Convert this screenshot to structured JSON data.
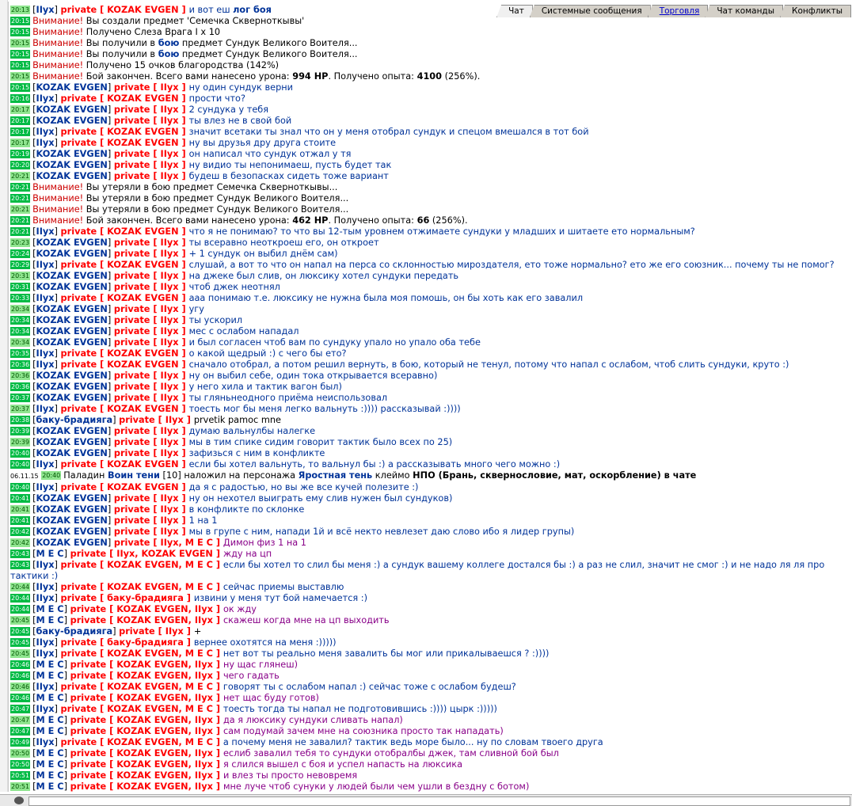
{
  "tabs": [
    {
      "label": "Чат",
      "active": true,
      "link": false
    },
    {
      "label": "Системные сообщения",
      "active": false,
      "link": false
    },
    {
      "label": "Торговля",
      "active": false,
      "link": true
    },
    {
      "label": "Чат команды",
      "active": false,
      "link": false
    },
    {
      "label": "Конфликты",
      "active": false,
      "link": false
    }
  ],
  "messages": [
    {
      "t": "20:13",
      "k": "c",
      "s": "IIух",
      "r": "KOZAK EVGEN",
      "x": "и вот еш ",
      "extra": "лог боя",
      "c": "b"
    },
    {
      "t": "20:15",
      "k": "w",
      "x": "Вы создали предмет 'Семечка Скверноткывы'"
    },
    {
      "t": "20:15",
      "k": "w",
      "x": "Получено Слеза Врага I x 10"
    },
    {
      "t": "20:15",
      "k": "w",
      "x": "Вы получили в ",
      "extra": "бою",
      "x2": " предмет Сундук Великого Воителя..."
    },
    {
      "t": "20:15",
      "k": "w",
      "x": "Вы получили в ",
      "extra": "бою",
      "x2": " предмет Сундук Великого Воителя..."
    },
    {
      "t": "20:15",
      "k": "w",
      "x": "Получено 15 очков благородства (142%)"
    },
    {
      "t": "20:15",
      "k": "w",
      "x": "Бой закончен. Всего вами нанесено урона: ",
      "b1": "994 HP",
      "x2": ". Получено опыта: ",
      "b2": "4100",
      "x3": " (256%)."
    },
    {
      "t": "20:15",
      "k": "c",
      "s": "KOZAK EVGEN",
      "r": "IIух",
      "x": "ну один сундук верни",
      "c": "b"
    },
    {
      "t": "20:16",
      "k": "c",
      "s": "IIух",
      "r": "KOZAK EVGEN",
      "x": "прости что?",
      "c": "b"
    },
    {
      "t": "20:17",
      "k": "c",
      "s": "KOZAK EVGEN",
      "r": "IIух",
      "x": "2 сундука у тебя",
      "c": "b"
    },
    {
      "t": "20:17",
      "k": "c",
      "s": "KOZAK EVGEN",
      "r": "IIух",
      "x": "ты влез не в свой бой",
      "c": "b"
    },
    {
      "t": "20:17",
      "k": "c",
      "s": "IIух",
      "r": "KOZAK EVGEN",
      "x": "значит всетаки ты знал что он у меня отобрал сундук и спецом вмешался в тот бой",
      "c": "b"
    },
    {
      "t": "20:17",
      "k": "c",
      "s": "IIух",
      "r": "KOZAK EVGEN",
      "x": "ну вы друзья дру друга стоите",
      "c": "b"
    },
    {
      "t": "20:19",
      "k": "c",
      "s": "KOZAK EVGEN",
      "r": "IIух",
      "x": "он написал что сундук отжал у тя",
      "c": "b"
    },
    {
      "t": "20:20",
      "k": "c",
      "s": "KOZAK EVGEN",
      "r": "IIух",
      "x": "ну видио ты непонимаеш, пусть будет так",
      "c": "b"
    },
    {
      "t": "20:21",
      "k": "c",
      "s": "KOZAK EVGEN",
      "r": "IIух",
      "x": "будеш в безопасках сидеть тоже вариант",
      "c": "b"
    },
    {
      "t": "20:21",
      "k": "w",
      "x": "Вы утеряли в бою предмет Семечка Скверноткывы..."
    },
    {
      "t": "20:21",
      "k": "w",
      "x": "Вы утеряли в бою предмет Сундук Великого Воителя..."
    },
    {
      "t": "20:21",
      "k": "w",
      "x": "Вы утеряли в бою предмет Сундук Великого Воителя..."
    },
    {
      "t": "20:21",
      "k": "w",
      "x": "Бой закончен. Всего вами нанесено урона: ",
      "b1": "462 HP",
      "x2": ". Получено опыта: ",
      "b2": "66",
      "x3": " (256%)."
    },
    {
      "t": "20:21",
      "k": "c",
      "s": "IIух",
      "r": "KOZAK EVGEN",
      "x": "что я не понимаю? то что вы 12-тым уровнем отжимаете сундуки у младших и шитаете ето нормальным?",
      "c": "b"
    },
    {
      "t": "20:23",
      "k": "c",
      "s": "KOZAK EVGEN",
      "r": "IIух",
      "x": "ты всеравно неоткроеш его, он откроет",
      "c": "b"
    },
    {
      "t": "20:24",
      "k": "c",
      "s": "KOZAK EVGEN",
      "r": "IIух",
      "x": "+ 1 сундук он выбил днём сам)",
      "c": "b"
    },
    {
      "t": "20:29",
      "k": "c",
      "s": "IIух",
      "r": "KOZAK EVGEN",
      "x": "слушай, а вот то что он напал на перса со склонностью мироздателя, ето тоже нормально? ето же его союзник... почему ты не помог?",
      "c": "b"
    },
    {
      "t": "20:31",
      "k": "c",
      "s": "KOZAK EVGEN",
      "r": "IIух",
      "x": "на джеке был слив, он люксику хотел сундуки передать",
      "c": "b"
    },
    {
      "t": "20:31",
      "k": "c",
      "s": "KOZAK EVGEN",
      "r": "IIух",
      "x": "чтоб джек неотнял",
      "c": "b"
    },
    {
      "t": "20:33",
      "k": "c",
      "s": "IIух",
      "r": "KOZAK EVGEN",
      "x": "ааа понимаю т.е. люксику не нужна была моя помошь, он бы хоть как его завалил",
      "c": "b"
    },
    {
      "t": "20:34",
      "k": "c",
      "s": "KOZAK EVGEN",
      "r": "IIух",
      "x": "угу",
      "c": "b"
    },
    {
      "t": "20:34",
      "k": "c",
      "s": "KOZAK EVGEN",
      "r": "IIух",
      "x": "ты ускорил",
      "c": "b"
    },
    {
      "t": "20:34",
      "k": "c",
      "s": "KOZAK EVGEN",
      "r": "IIух",
      "x": "мес с ослабом нападал",
      "c": "b"
    },
    {
      "t": "20:34",
      "k": "c",
      "s": "KOZAK EVGEN",
      "r": "IIух",
      "x": "и был согласен чтоб вам по сундуку упало но упало оба тебе",
      "c": "b"
    },
    {
      "t": "20:35",
      "k": "c",
      "s": "IIух",
      "r": "KOZAK EVGEN",
      "x": "о какой щедрый :) с чего бы ето?",
      "c": "b"
    },
    {
      "t": "20:36",
      "k": "c",
      "s": "IIух",
      "r": "KOZAK EVGEN",
      "x": "сначало отобрал, а потом решил вернуть, в бою, который не тенул, потому что напал с ослабом, чтоб слить сундуки, круто :)",
      "c": "b"
    },
    {
      "t": "20:36",
      "k": "c",
      "s": "KOZAK EVGEN",
      "r": "IIух",
      "x": "ну он выбил себе, один тока открывается всеравно)",
      "c": "b"
    },
    {
      "t": "20:36",
      "k": "c",
      "s": "KOZAK EVGEN",
      "r": "IIух",
      "x": "у него хила и тактик вагон был)",
      "c": "b"
    },
    {
      "t": "20:37",
      "k": "c",
      "s": "KOZAK EVGEN",
      "r": "IIух",
      "x": "ты гляньнеодного приёма неиспользовал",
      "c": "b"
    },
    {
      "t": "20:37",
      "k": "c",
      "s": "IIух",
      "r": "KOZAK EVGEN",
      "x": "тоесть мог бы меня легко вальнуть :)))) рассказывай :))))",
      "c": "b"
    },
    {
      "t": "20:38",
      "k": "c",
      "s": "баку-брадияга",
      "r": "IIух",
      "x": "prvetik pamoc mne",
      "c": "k"
    },
    {
      "t": "20:39",
      "k": "c",
      "s": "KOZAK EVGEN",
      "r": "IIух",
      "x": "думаю вальнулбы налегке",
      "c": "b"
    },
    {
      "t": "20:39",
      "k": "c",
      "s": "KOZAK EVGEN",
      "r": "IIух",
      "x": "мы в тим спике сидим говорит тактик было всех по 25)",
      "c": "b"
    },
    {
      "t": "20:40",
      "k": "c",
      "s": "KOZAK EVGEN",
      "r": "IIух",
      "x": "зафизься с ним в конфликте",
      "c": "b"
    },
    {
      "t": "20:40",
      "k": "c",
      "s": "IIух",
      "r": "KOZAK EVGEN",
      "x": "если бы хотел вальнуть, то вальнул бы :) а рассказывать много чего можно :)",
      "c": "b"
    },
    {
      "t": "20:40",
      "k": "sys",
      "d": "06.11.15",
      "x": "Паладин ",
      "n1": "Воин тени",
      "x2": " [10] наложил на персонажа ",
      "n2": "Яростная тень",
      "x3": " клеймо ",
      "n3": "НПО (Брань, сквернословие, мат, оскорбление) в чате"
    },
    {
      "t": "20:40",
      "k": "c",
      "s": "IIух",
      "r": "KOZAK EVGEN",
      "x": "да я с радостью, но вы же все кучей полезите :)",
      "c": "b"
    },
    {
      "t": "20:41",
      "k": "c",
      "s": "KOZAK EVGEN",
      "r": "IIух",
      "x": "ну он нехотел выиграть ему слив нужен был сундуков)",
      "c": "b"
    },
    {
      "t": "20:41",
      "k": "c",
      "s": "KOZAK EVGEN",
      "r": "IIух",
      "x": "в конфликте по склонке",
      "c": "b"
    },
    {
      "t": "20:41",
      "k": "c",
      "s": "KOZAK EVGEN",
      "r": "IIух",
      "x": "1 на 1",
      "c": "b"
    },
    {
      "t": "20:42",
      "k": "c",
      "s": "KOZAK EVGEN",
      "r": "IIух",
      "x": "мы в групе с ним, напади 1й и всё некто невлезет даю слово ибо я лидер групы)",
      "c": "b"
    },
    {
      "t": "20:42",
      "k": "c",
      "s": "KOZAK EVGEN",
      "r": "IIух, M E C",
      "x": "Димон физ 1 на 1",
      "c": "p"
    },
    {
      "t": "20:43",
      "k": "c",
      "s": "M E C",
      "r": "IIух, KOZAK EVGEN",
      "x": "жду на цп",
      "c": "p"
    },
    {
      "t": "20:43",
      "k": "c",
      "s": "IIух",
      "r": "KOZAK EVGEN, M E C",
      "x": "если бы хотел то слил бы меня :) а сундук вашему коллеге достался бы :) а раз не слил, значит не смог :) и не надо ля ля про тактики :)",
      "c": "b",
      "wrap": true
    },
    {
      "t": "20:44",
      "k": "c",
      "s": "IIух",
      "r": "KOZAK EVGEN, M E C",
      "x": "сейчас приемы выставлю",
      "c": "b"
    },
    {
      "t": "20:44",
      "k": "c",
      "s": "IIух",
      "r": "баку-брадияга",
      "x": "извини у меня тут бой намечается :)",
      "c": "b"
    },
    {
      "t": "20:44",
      "k": "c",
      "s": "M E C",
      "r": "KOZAK EVGEN, IIух",
      "x": "ок жду",
      "c": "p"
    },
    {
      "t": "20:45",
      "k": "c",
      "s": "M E C",
      "r": "KOZAK EVGEN, IIух",
      "x": "скажеш когда мне на цп выходить",
      "c": "p"
    },
    {
      "t": "20:45",
      "k": "c",
      "s": "баку-брадияга",
      "r": "IIух",
      "x": "+",
      "c": "k"
    },
    {
      "t": "20:45",
      "k": "c",
      "s": "IIух",
      "r": "баку-брадияга",
      "x": "вернее охотятся на меня :)))))",
      "c": "b"
    },
    {
      "t": "20:45",
      "k": "c",
      "s": "IIух",
      "r": "KOZAK EVGEN, M E C",
      "x": "нет вот ты реально меня завалить бы мог или прикалываешся ? :))))",
      "c": "b"
    },
    {
      "t": "20:46",
      "k": "c",
      "s": "M E C",
      "r": "KOZAK EVGEN, IIух",
      "x": "ну щас глянеш)",
      "c": "p"
    },
    {
      "t": "20:46",
      "k": "c",
      "s": "M E C",
      "r": "KOZAK EVGEN, IIух",
      "x": "чего гадать",
      "c": "p"
    },
    {
      "t": "20:46",
      "k": "c",
      "s": "IIух",
      "r": "KOZAK EVGEN, M E C",
      "x": "говорят ты с ослабом напал :) сейчас тоже с ослабом будеш?",
      "c": "b"
    },
    {
      "t": "20:46",
      "k": "c",
      "s": "M E C",
      "r": "KOZAK EVGEN, IIух",
      "x": "нет щас буду готов)",
      "c": "p"
    },
    {
      "t": "20:47",
      "k": "c",
      "s": "IIух",
      "r": "KOZAK EVGEN, M E C",
      "x": "тоесть тогда ты напал не подготовившись :)))) цырк :)))))",
      "c": "b"
    },
    {
      "t": "20:47",
      "k": "c",
      "s": "M E C",
      "r": "KOZAK EVGEN, IIух",
      "x": "да я люксику сундуки сливать напал)",
      "c": "p"
    },
    {
      "t": "20:47",
      "k": "c",
      "s": "M E C",
      "r": "KOZAK EVGEN, IIух",
      "x": "сам подумай зачем мне на союзника просто так нападать)",
      "c": "p"
    },
    {
      "t": "20:49",
      "k": "c",
      "s": "IIух",
      "r": "KOZAK EVGEN, M E C",
      "x": "а почему меня не завалил? тактик ведь море было... ну по словам твоего друга",
      "c": "b"
    },
    {
      "t": "20:50",
      "k": "c",
      "s": "M E C",
      "r": "KOZAK EVGEN, IIух",
      "x": "еслиб завалил тебя то сундуки отобралбы джек, там сливной бой был",
      "c": "p"
    },
    {
      "t": "20:50",
      "k": "c",
      "s": "M E C",
      "r": "KOZAK EVGEN, IIух",
      "x": "я слился вышел с боя и успел напасть на люксика",
      "c": "p"
    },
    {
      "t": "20:51",
      "k": "c",
      "s": "M E C",
      "r": "KOZAK EVGEN, IIух",
      "x": "и влез ты просто невовремя",
      "c": "p"
    },
    {
      "t": "20:51",
      "k": "c",
      "s": "M E C",
      "r": "KOZAK EVGEN, IIух",
      "x": "мне луче чтоб сунуки у людей были чем ушли в бездну с ботом)",
      "c": "p"
    }
  ],
  "strings": {
    "private": "private",
    "warn_prefix": "Внимание!"
  },
  "colors": {
    "timestamp_bg": "#00bb44",
    "private": "#ff0000",
    "warning": "#cc0000",
    "name": "#003399",
    "purple": "#880088"
  }
}
